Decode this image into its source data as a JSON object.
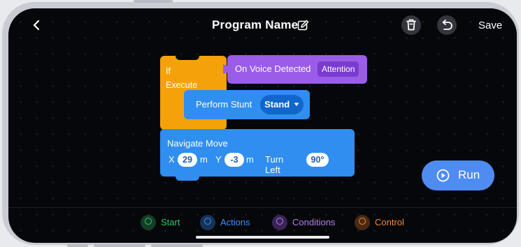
{
  "header": {
    "back_icon": "chevron-left-icon",
    "title": "Program Name",
    "edit_icon": "pencil-square-icon",
    "delete_icon": "trash-icon",
    "undo_icon": "undo-arrow-icon",
    "save_label": "Save"
  },
  "blocks": {
    "if_block": {
      "if_label": "If",
      "execute_label": "Execute",
      "color": "#f5a20a"
    },
    "condition": {
      "label": "On Voice Detected",
      "value": "Attention",
      "color": "#9b5ce8"
    },
    "stunt": {
      "label": "Perform Stunt",
      "value": "Stand",
      "dropdown_icon": "caret-down-icon",
      "color": "#2f8ef0"
    },
    "navigate": {
      "title": "Navigate Move",
      "x_label": "X",
      "x_value": "29",
      "x_unit": "m",
      "y_label": "Y",
      "y_value": "-3",
      "y_unit": "m",
      "turn_label": "Turn Left",
      "turn_value": "90°"
    }
  },
  "run_button": {
    "label": "Run",
    "icon": "play-circle-icon",
    "color": "#4f8cf2"
  },
  "categories": [
    {
      "label": "Start",
      "color": "#2fc86b"
    },
    {
      "label": "Actions",
      "color": "#3d8ff5"
    },
    {
      "label": "Conditions",
      "color": "#b57cf0"
    },
    {
      "label": "Control",
      "color": "#f0893a"
    }
  ]
}
